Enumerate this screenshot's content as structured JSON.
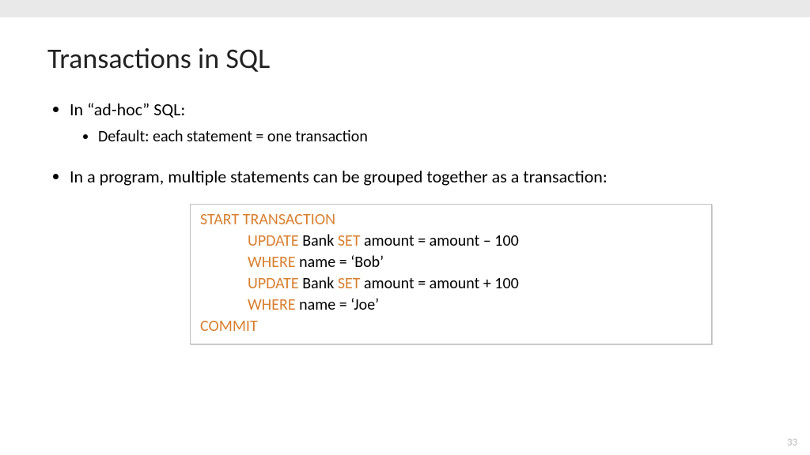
{
  "title": "Transactions in SQL",
  "bullets": {
    "b1": "In “ad-hoc” SQL:",
    "b1_sub1": "Default: each statement = one transaction",
    "b2": "In a program, multiple statements can be grouped together as a transaction:"
  },
  "code": {
    "kw_start": "START TRANSACTION",
    "kw_update1": "UPDATE",
    "txt_bank1": " Bank ",
    "kw_set1": "SET",
    "txt_set1": " amount = amount – 100",
    "kw_where1": "WHERE",
    "txt_where1": " name = ‘Bob’",
    "kw_update2": "UPDATE",
    "txt_bank2": " Bank ",
    "kw_set2": "SET",
    "txt_set2": " amount = amount + 100",
    "kw_where2": "WHERE",
    "txt_where2": " name = ‘Joe’",
    "kw_commit": "COMMIT"
  },
  "page_number": "33"
}
